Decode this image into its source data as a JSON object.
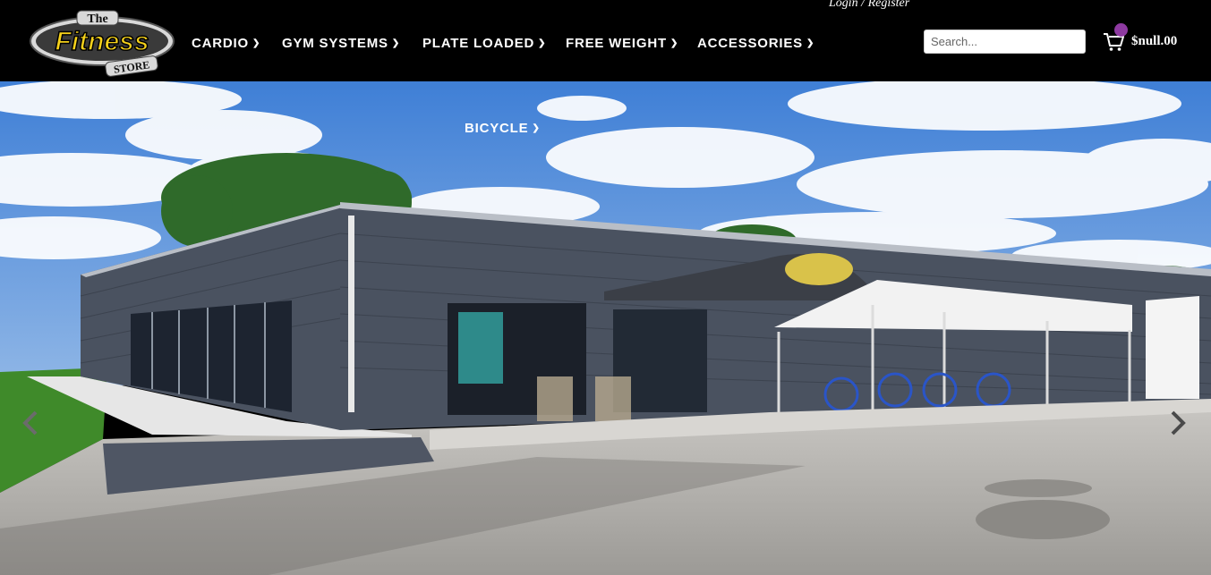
{
  "header": {
    "logo_alt": "The Fitness Store",
    "nav": [
      {
        "label": "CARDIO"
      },
      {
        "label": "GYM SYSTEMS"
      },
      {
        "label": "PLATE LOADED"
      },
      {
        "label": "FREE WEIGHT"
      },
      {
        "label": "ACCESSORIES"
      },
      {
        "label": "BICYCLE"
      }
    ],
    "login_label": "Login / Register",
    "search_placeholder": "Search...",
    "cart_total": "$null.00"
  },
  "hero": {
    "image_description_icon": "storefront-photo",
    "prev_icon": "chevron-left-icon",
    "next_icon": "chevron-right-icon"
  },
  "colors": {
    "header_bg": "#000000",
    "badge": "#8e3aa1",
    "logo_yellow": "#f6d21b"
  }
}
